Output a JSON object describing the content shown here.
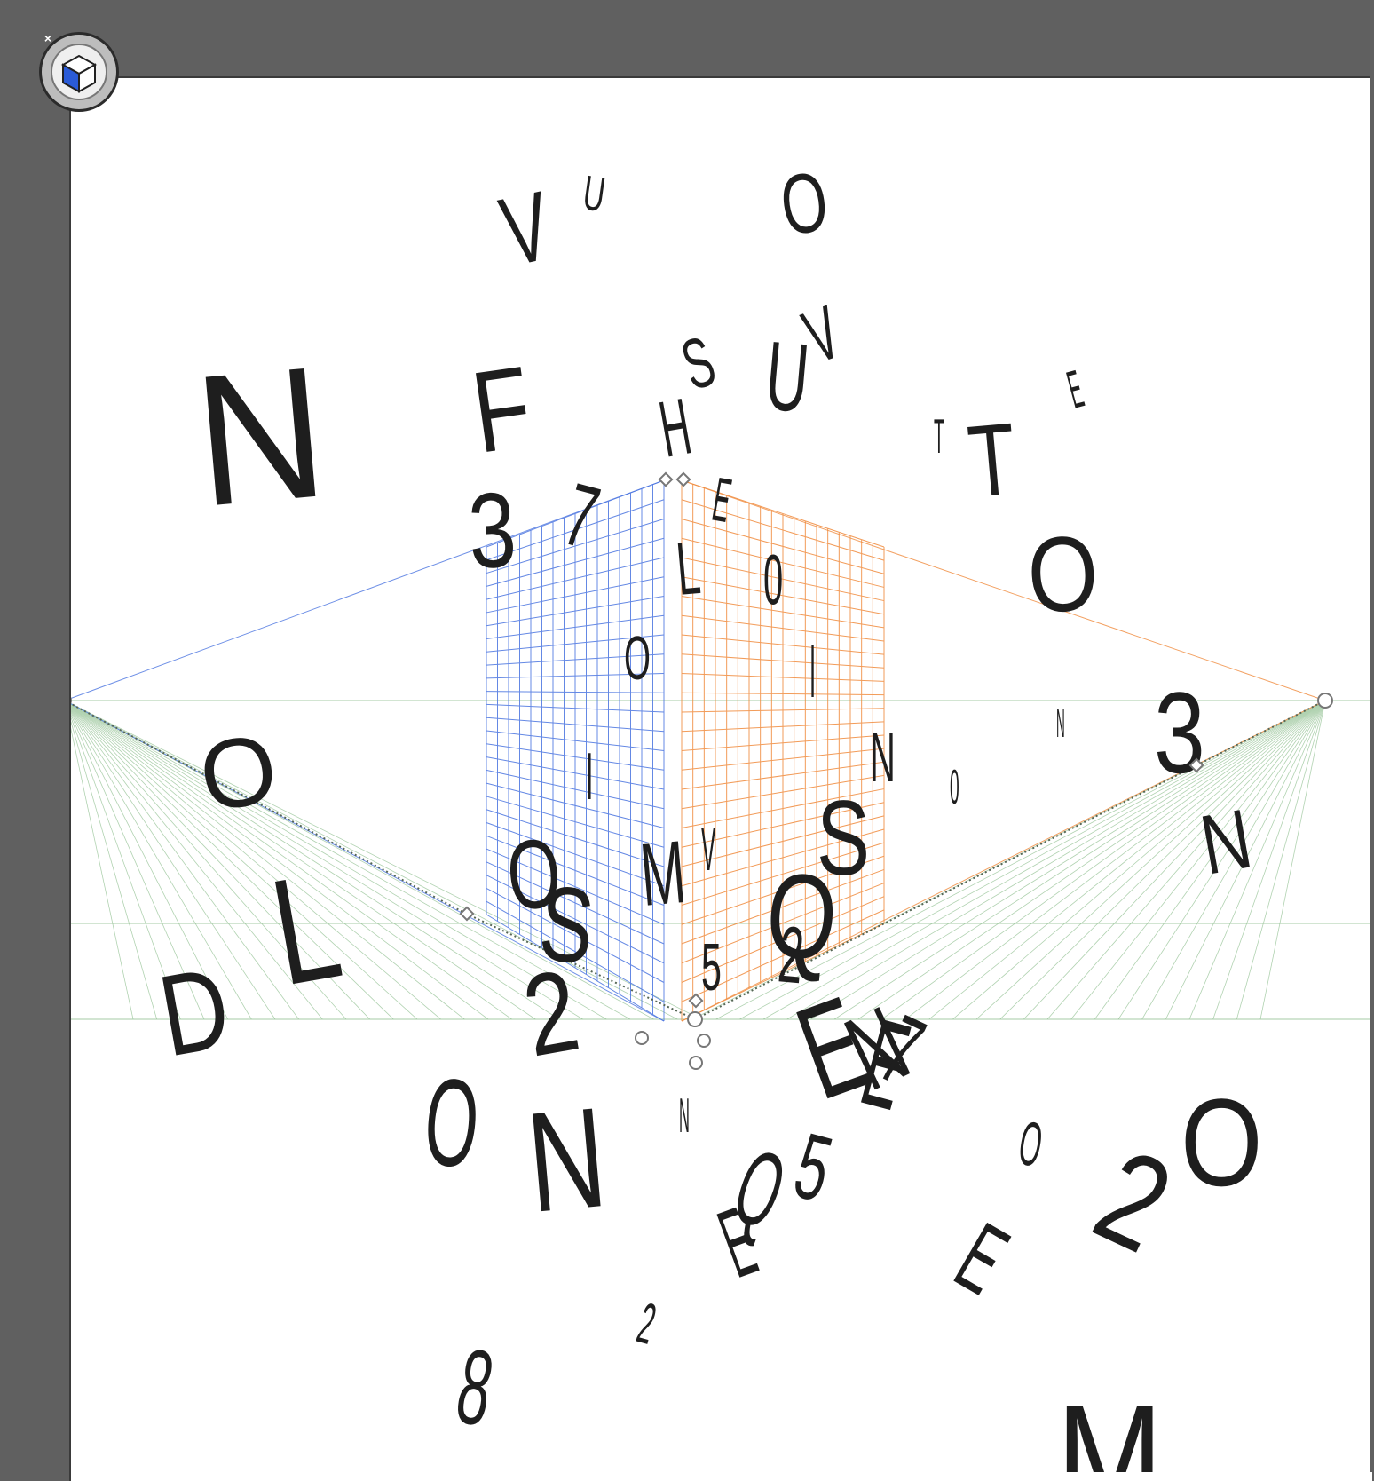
{
  "tool": {
    "icon": "perspective-grid-cube-icon",
    "close_icon": "close-icon",
    "close_glyph": "×"
  },
  "canvas": {
    "background": "#ffffff",
    "workspace_color": "#606060"
  },
  "perspective_grid": {
    "left_plane_color": "#4a74e0",
    "right_plane_color": "#f08a3c",
    "ground_plane_color": "#8fbf8f",
    "handle_color": "#777777"
  },
  "letters": [
    "V",
    "U",
    "O",
    "N",
    "F",
    "S",
    "U",
    "V",
    "H",
    "E",
    "T",
    "T",
    "E",
    "3",
    "7",
    "L",
    "0",
    "O",
    "O",
    "I",
    "I",
    "N",
    "3",
    "N",
    "0",
    "N",
    "O",
    "L",
    "D",
    "O",
    "S",
    "M",
    "V",
    "S",
    "Q",
    "2",
    "5",
    "2",
    "N",
    "E",
    "O",
    "N",
    "N",
    "E",
    "7",
    "Q",
    "5",
    "O",
    "2",
    "O",
    "E",
    "E",
    "2",
    "8",
    "M"
  ]
}
